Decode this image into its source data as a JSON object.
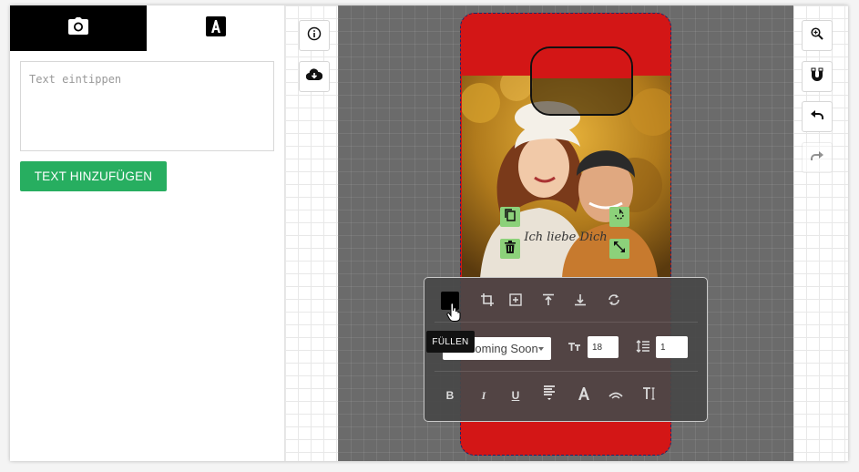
{
  "tabs": [
    {
      "icon": "camera-icon",
      "active": true
    },
    {
      "icon": "text-icon",
      "active": false
    }
  ],
  "text_input": {
    "placeholder": "Text eintippen",
    "value": ""
  },
  "add_button": {
    "label": "TEXT HINZUFÜGEN"
  },
  "colors": {
    "accent": "#27ae60",
    "phone_case": "#d31616",
    "handle": "#8cd17a"
  },
  "left_tools": [
    "info-icon",
    "cloud-download-icon"
  ],
  "right_tools": [
    "zoom-in-icon",
    "magnet-icon",
    "undo-icon",
    "redo-icon"
  ],
  "canvas": {
    "text_element": "Ich liebe Dich"
  },
  "toolbar": {
    "row1": [
      "fill-icon",
      "crop-icon",
      "align-center-icon",
      "align-top-icon",
      "align-bottom-icon",
      "rotate-icon"
    ],
    "tooltip": "FÜLLEN",
    "font": "Coming Soon",
    "font_size": "18",
    "line_height": "1",
    "row3": [
      "bold-icon",
      "italic-icon",
      "underline-icon",
      "align-left-icon",
      "font-color-icon",
      "curved-text-icon",
      "text-cursor-icon"
    ]
  }
}
